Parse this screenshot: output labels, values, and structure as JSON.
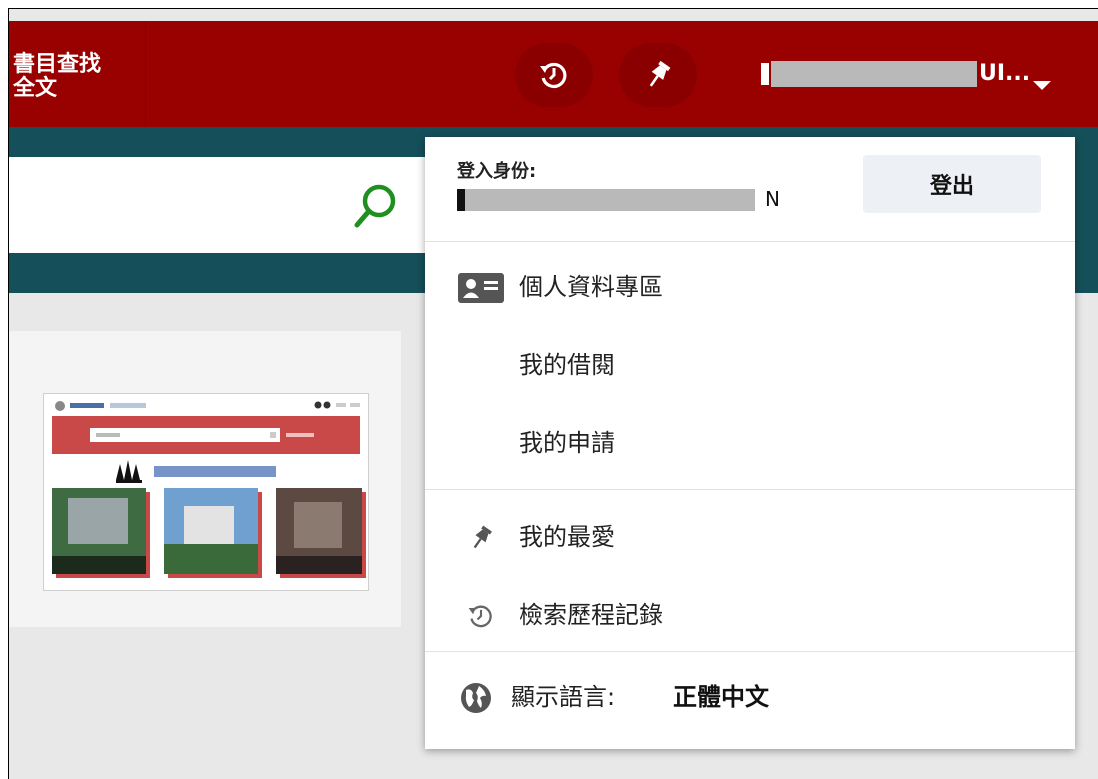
{
  "header": {
    "nav_search_line1": "書目查找",
    "nav_search_line2": "全文",
    "user_suffix": "UI...",
    "history_icon": "history-icon",
    "pin_icon": "pin-icon",
    "caret_icon": "caret-down-icon"
  },
  "search": {
    "icon": "magnifier-icon"
  },
  "dropdown": {
    "login_label": "登入身份:",
    "login_id_suffix": "N",
    "logout_label": "登出",
    "items": [
      {
        "label": "個人資料專區",
        "icon": "id-card-icon"
      },
      {
        "label": "我的借閱",
        "icon": ""
      },
      {
        "label": "我的申請",
        "icon": ""
      },
      {
        "label": "我的最愛",
        "icon": "pin-icon"
      },
      {
        "label": "檢索歷程記錄",
        "icon": "history-icon"
      }
    ],
    "language_label": "顯示語言:",
    "language_value": "正體中文",
    "language_icon": "globe-icon"
  },
  "colors": {
    "header_bg": "#990000",
    "teal": "#154f5a",
    "search_icon": "#1f8f1f"
  }
}
